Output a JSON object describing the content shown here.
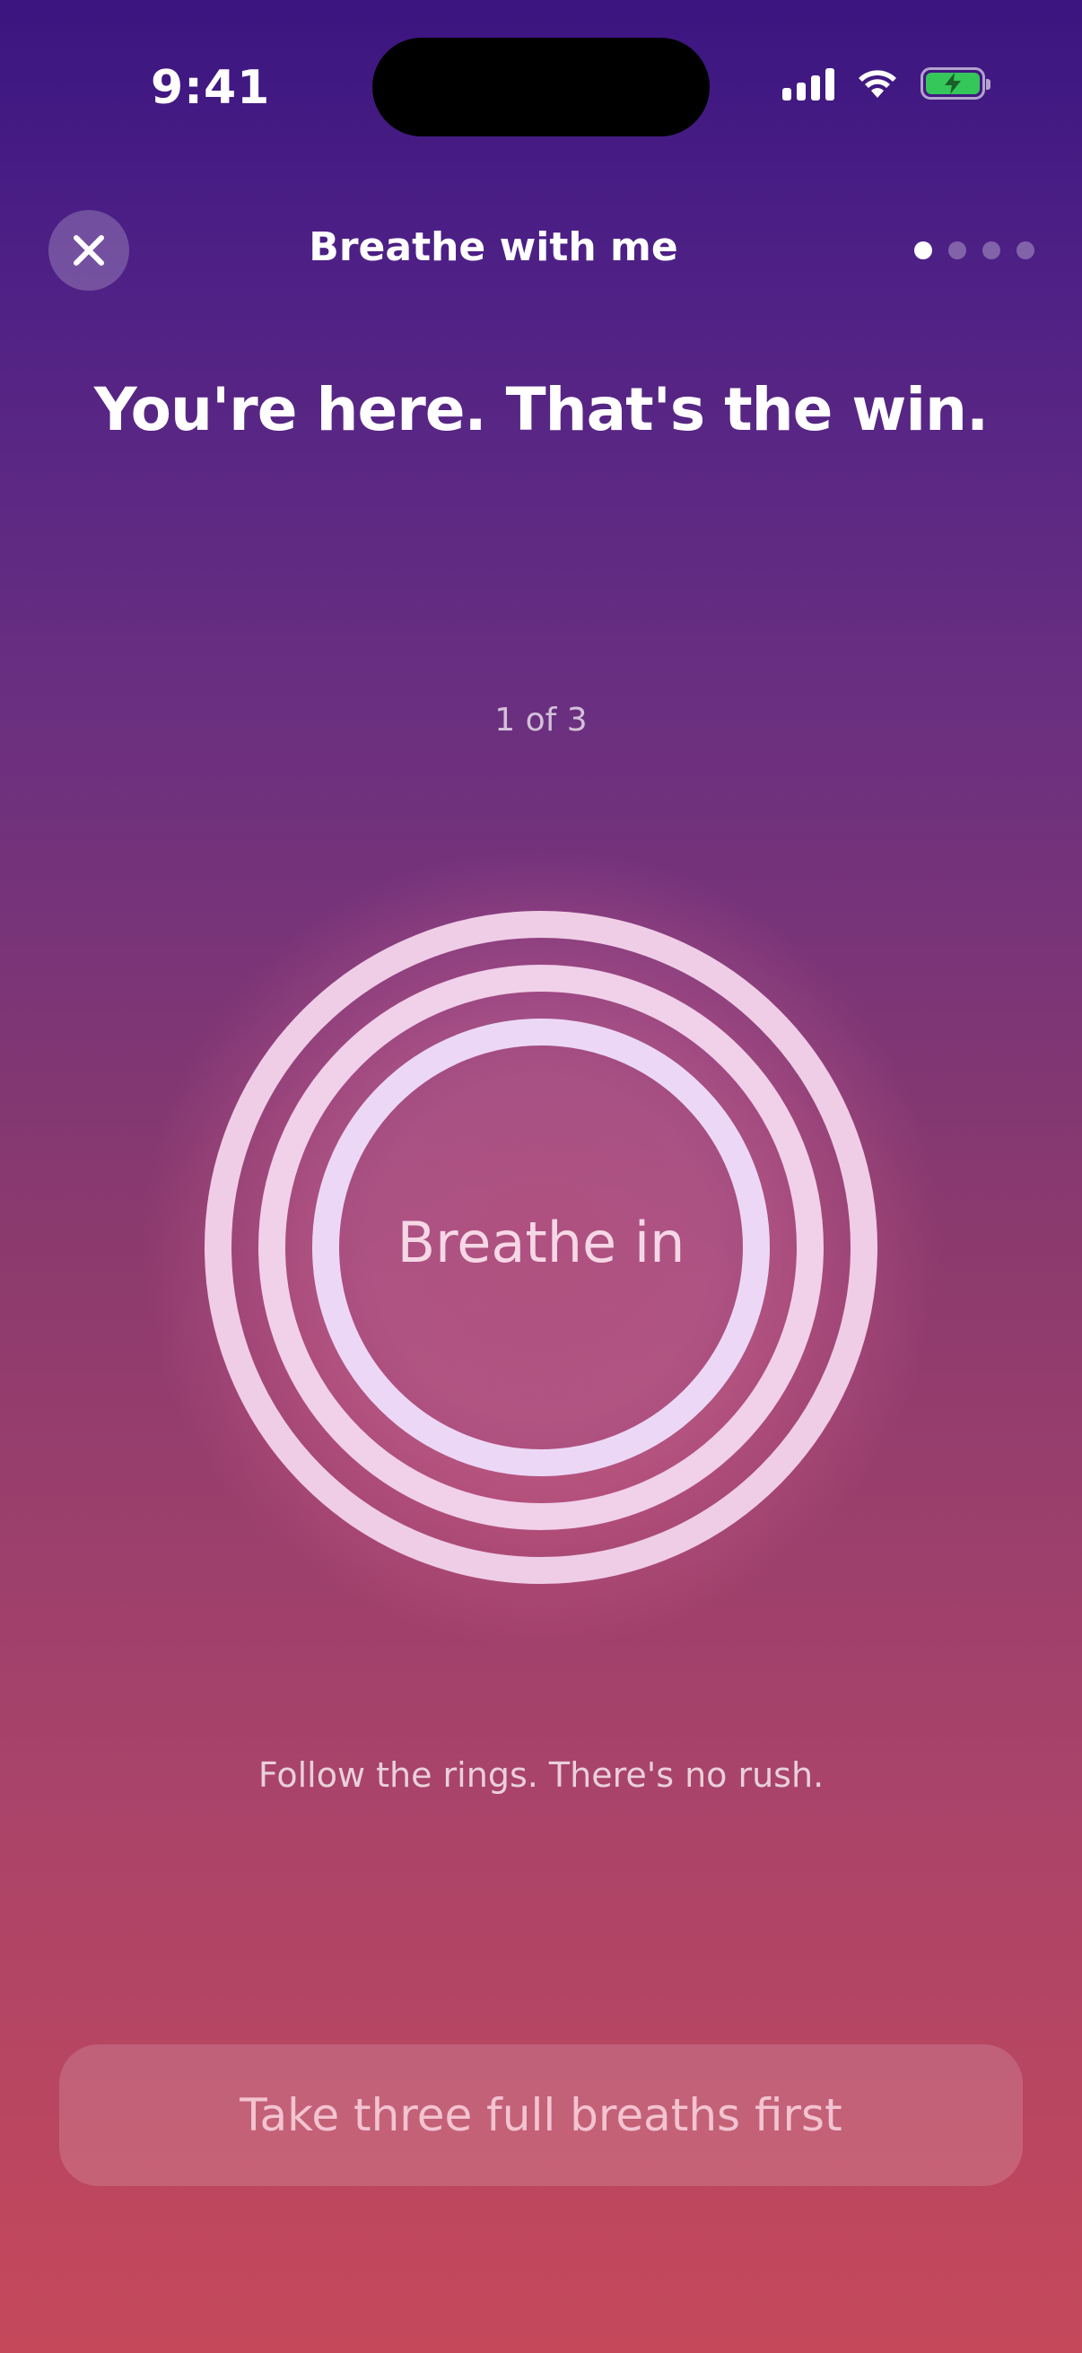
{
  "status_bar": {
    "time": "9:41"
  },
  "header": {
    "title": "Breathe with me",
    "pager": {
      "total": 4,
      "active": 1
    }
  },
  "headline": "You're here. That's the win.",
  "counter": "1 of 3",
  "exercise": {
    "prompt": "Breathe in"
  },
  "hint": "Follow the rings. There's no rush.",
  "cta": {
    "label": "Take three full breaths first"
  },
  "icons": {
    "close": "close-icon",
    "signal": "signal-icon",
    "wifi": "wifi-icon",
    "battery": "battery-charging-icon"
  },
  "colors": {
    "battery": "#35c759",
    "ring": "#efcde6"
  }
}
